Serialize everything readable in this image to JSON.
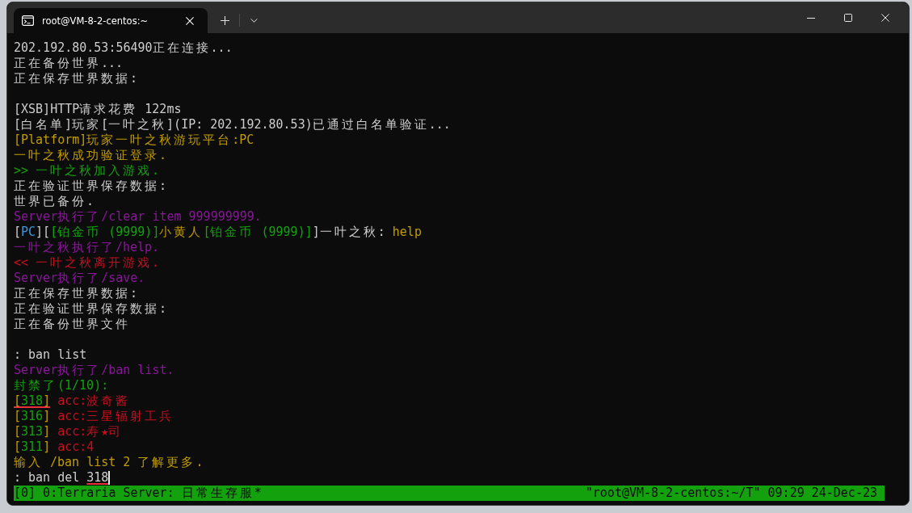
{
  "window": {
    "tab": {
      "title": "root@VM-8-2-centos:~",
      "selected": true
    }
  },
  "terminal": {
    "lines": [
      {
        "kind": "text",
        "segments": [
          {
            "text": "202.192.80.53:56490正在连接...",
            "color": "#cccccc"
          }
        ]
      },
      {
        "kind": "text",
        "segments": [
          {
            "text": "正在备份世界...",
            "color": "#cccccc"
          }
        ]
      },
      {
        "kind": "text",
        "segments": [
          {
            "text": "正在保存世界数据:",
            "color": "#cccccc"
          }
        ]
      },
      {
        "kind": "blank"
      },
      {
        "kind": "text",
        "segments": [
          {
            "text": "[XSB]HTTP请求花费 122ms",
            "color": "#cccccc"
          }
        ]
      },
      {
        "kind": "text",
        "segments": [
          {
            "text": "[白名单]玩家[一叶之秋](IP: 202.192.80.53)已通过白名单验证...",
            "color": "#cccccc"
          }
        ]
      },
      {
        "kind": "text",
        "segments": [
          {
            "text": "[Platform]玩家一叶之秋游玩平台:PC",
            "color": "#c19c00"
          }
        ]
      },
      {
        "kind": "text",
        "segments": [
          {
            "text": "一叶之秋成功验证登录.",
            "color": "#c19c00"
          }
        ]
      },
      {
        "kind": "text",
        "segments": [
          {
            "text": ">> 一叶之秋加入游戏.",
            "color": "#13a10e"
          }
        ]
      },
      {
        "kind": "text",
        "segments": [
          {
            "text": "正在验证世界保存数据:",
            "color": "#cccccc"
          }
        ]
      },
      {
        "kind": "text",
        "segments": [
          {
            "text": "世界已备份.",
            "color": "#cccccc"
          }
        ]
      },
      {
        "kind": "text",
        "segments": [
          {
            "text": "Server执行了/clear item 999999999.",
            "color": "#881798"
          }
        ]
      },
      {
        "kind": "text",
        "segments": [
          {
            "text": "[",
            "color": "#cccccc"
          },
          {
            "text": "PC",
            "color": "#3a96dd"
          },
          {
            "text": "][",
            "color": "#cccccc"
          },
          {
            "text": "[铂金币 (9999)]",
            "color": "#13a10e"
          },
          {
            "text": "小黄人",
            "color": "#c19c00"
          },
          {
            "text": "[铂金币 (9999)]",
            "color": "#13a10e"
          },
          {
            "text": "]一叶之秋: ",
            "color": "#cccccc"
          },
          {
            "text": "help",
            "color": "#c19c00"
          }
        ]
      },
      {
        "kind": "text",
        "segments": [
          {
            "text": "一叶之秋执行了/help.",
            "color": "#881798"
          }
        ]
      },
      {
        "kind": "text",
        "segments": [
          {
            "text": "<< 一叶之秋离开游戏.",
            "color": "#c50f1f"
          }
        ]
      },
      {
        "kind": "text",
        "segments": [
          {
            "text": "Server执行了/save.",
            "color": "#881798"
          }
        ]
      },
      {
        "kind": "text",
        "segments": [
          {
            "text": "正在保存世界数据:",
            "color": "#cccccc"
          }
        ]
      },
      {
        "kind": "text",
        "segments": [
          {
            "text": "正在验证世界保存数据:",
            "color": "#cccccc"
          }
        ]
      },
      {
        "kind": "text",
        "segments": [
          {
            "text": "正在备份世界文件",
            "color": "#cccccc"
          }
        ]
      },
      {
        "kind": "blank"
      },
      {
        "kind": "text",
        "segments": [
          {
            "text": ": ban list",
            "color": "#cccccc"
          }
        ]
      },
      {
        "kind": "text",
        "segments": [
          {
            "text": "Server执行了/ban list.",
            "color": "#881798"
          }
        ]
      },
      {
        "kind": "text",
        "segments": [
          {
            "text": "封禁了(1/10):",
            "color": "#13a10e"
          }
        ]
      },
      {
        "kind": "text",
        "segments": [
          {
            "text": "[",
            "color": "#c19c00",
            "underlined": true
          },
          {
            "text": "318",
            "color": "#13a10e",
            "underlined": true
          },
          {
            "text": "]",
            "color": "#c19c00",
            "underlined": true
          },
          {
            "text": " acc:波奇酱",
            "color": "#c50f1f"
          }
        ]
      },
      {
        "kind": "text",
        "segments": [
          {
            "text": "[",
            "color": "#c19c00"
          },
          {
            "text": "316",
            "color": "#13a10e"
          },
          {
            "text": "]",
            "color": "#c19c00"
          },
          {
            "text": " acc:三星辐射工兵",
            "color": "#c50f1f"
          }
        ]
      },
      {
        "kind": "text",
        "segments": [
          {
            "text": "[",
            "color": "#c19c00"
          },
          {
            "text": "313",
            "color": "#13a10e"
          },
          {
            "text": "]",
            "color": "#c19c00"
          },
          {
            "text": " acc:寿★司",
            "color": "#c50f1f"
          }
        ]
      },
      {
        "kind": "text",
        "segments": [
          {
            "text": "[",
            "color": "#c19c00"
          },
          {
            "text": "311",
            "color": "#13a10e"
          },
          {
            "text": "]",
            "color": "#c19c00"
          },
          {
            "text": " acc:4",
            "color": "#c50f1f"
          }
        ]
      },
      {
        "kind": "text",
        "segments": [
          {
            "text": "输入 /ban list 2 了解更多.",
            "color": "#c19c00"
          }
        ]
      },
      {
        "kind": "prompt",
        "cursor": true,
        "segments": [
          {
            "text": ": ban del ",
            "color": "#cccccc"
          },
          {
            "text": "318",
            "color": "#cccccc",
            "underlined": true
          }
        ]
      }
    ]
  },
  "status_bar": {
    "left": "[0] 0:Terraria Server: 日常生存服*",
    "right": "\"root@VM-8-2-centos:~/T\" 09:29 24-Dec-23"
  }
}
